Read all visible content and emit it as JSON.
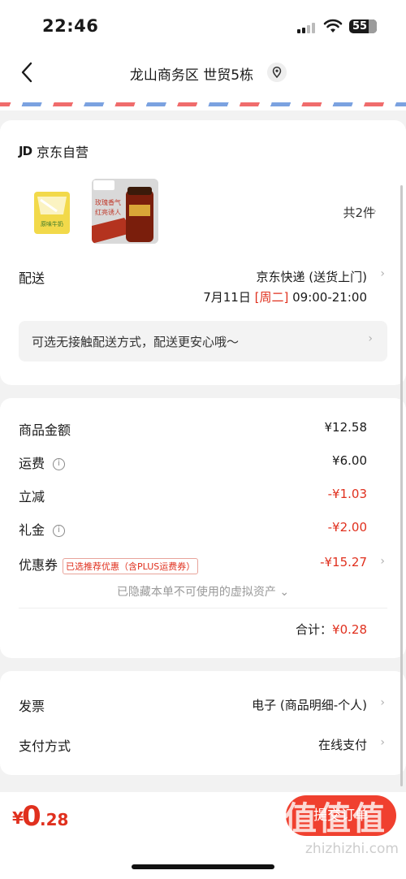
{
  "status_bar": {
    "time": "22:46",
    "battery": "55"
  },
  "nav": {
    "title": "龙山商务区 世贸5栋"
  },
  "shop": {
    "logo": "JD",
    "name": "京东自营"
  },
  "products": {
    "item1_label": "原味牛奶",
    "item2_text_line1": "玫瑰香气",
    "item2_text_line2": "红亮诱人",
    "count_label": "共2件"
  },
  "delivery": {
    "label": "配送",
    "method": "京东快递 (送货上门)",
    "date": "7月11日",
    "weekday": "[周二]",
    "time_window": "09:00-21:00",
    "tip": "可选无接触配送方式，配送更安心哦～"
  },
  "fees": {
    "goods_amount": {
      "label": "商品金额",
      "value": "¥12.58"
    },
    "shipping": {
      "label": "运费",
      "value": "¥6.00"
    },
    "instant_discount": {
      "label": "立减",
      "value": "-¥1.03"
    },
    "gift_money": {
      "label": "礼金",
      "value": "-¥2.00"
    },
    "coupon": {
      "label": "优惠券",
      "tag": "已选推荐优惠（含PLUS运费券）",
      "value": "-¥15.27"
    },
    "hidden_note": "已隐藏本单不可使用的虚拟资产 ⌄",
    "total_label": "合计：",
    "total_value": "¥0.28"
  },
  "invoice": {
    "label": "发票",
    "value": "电子 (商品明细-个人)"
  },
  "payment": {
    "label": "支付方式",
    "value": "在线支付"
  },
  "bottom": {
    "yen": "¥",
    "int": "0",
    "dec": ".28",
    "submit_label": "提交订单"
  },
  "watermark": {
    "logo": "值值值",
    "url": "zhizhizhi.com"
  },
  "colors": {
    "accent": "#e0301e",
    "button": "#f0402f"
  }
}
